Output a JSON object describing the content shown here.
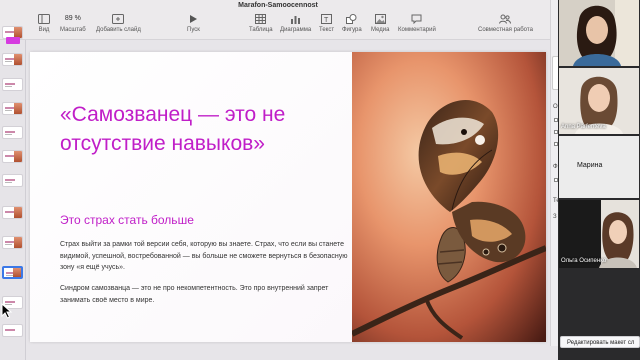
{
  "app": {
    "doc_title": "Marafon-Samoocennost"
  },
  "toolbar": {
    "view_label": "Вид",
    "zoom_value": "89 %",
    "zoom_label": "Масштаб",
    "add_slide_label": "Добавить слайд",
    "play_label": "Пуск",
    "table_label": "Таблица",
    "chart_label": "Диаграмма",
    "text_label": "Текст",
    "shape_label": "Фигура",
    "media_label": "Медиа",
    "comment_label": "Комментарий",
    "collab_label": "Совместная работа"
  },
  "slide": {
    "title": "«Самозванец — это не отсутствие навыков»",
    "subtitle": "Это страх стать больше",
    "paragraph1": "Страх выйти за рамки той версии себя, которую вы знаете. Страх, что если вы станете видимой, успешной, востребованной — вы больше не сможете вернуться в безопасную зону «я ещё учусь».",
    "paragraph2": "Синдром самозванца — это не про некомпетентность. Это про внутренний запрет занимать своё место в мире."
  },
  "inspector": {
    "letters": [
      "О",
      "Ф",
      "Те",
      "З"
    ]
  },
  "participants": [
    {
      "name": ""
    },
    {
      "name": "Anna Parfenteva"
    },
    {
      "name": "Марина"
    },
    {
      "name": "Ольга Осипенко"
    }
  ],
  "bottom": {
    "edit_layout_label": "Редактировать макет сл"
  },
  "colors": {
    "accent": "#c01ec8",
    "selection": "#3b78e7"
  }
}
